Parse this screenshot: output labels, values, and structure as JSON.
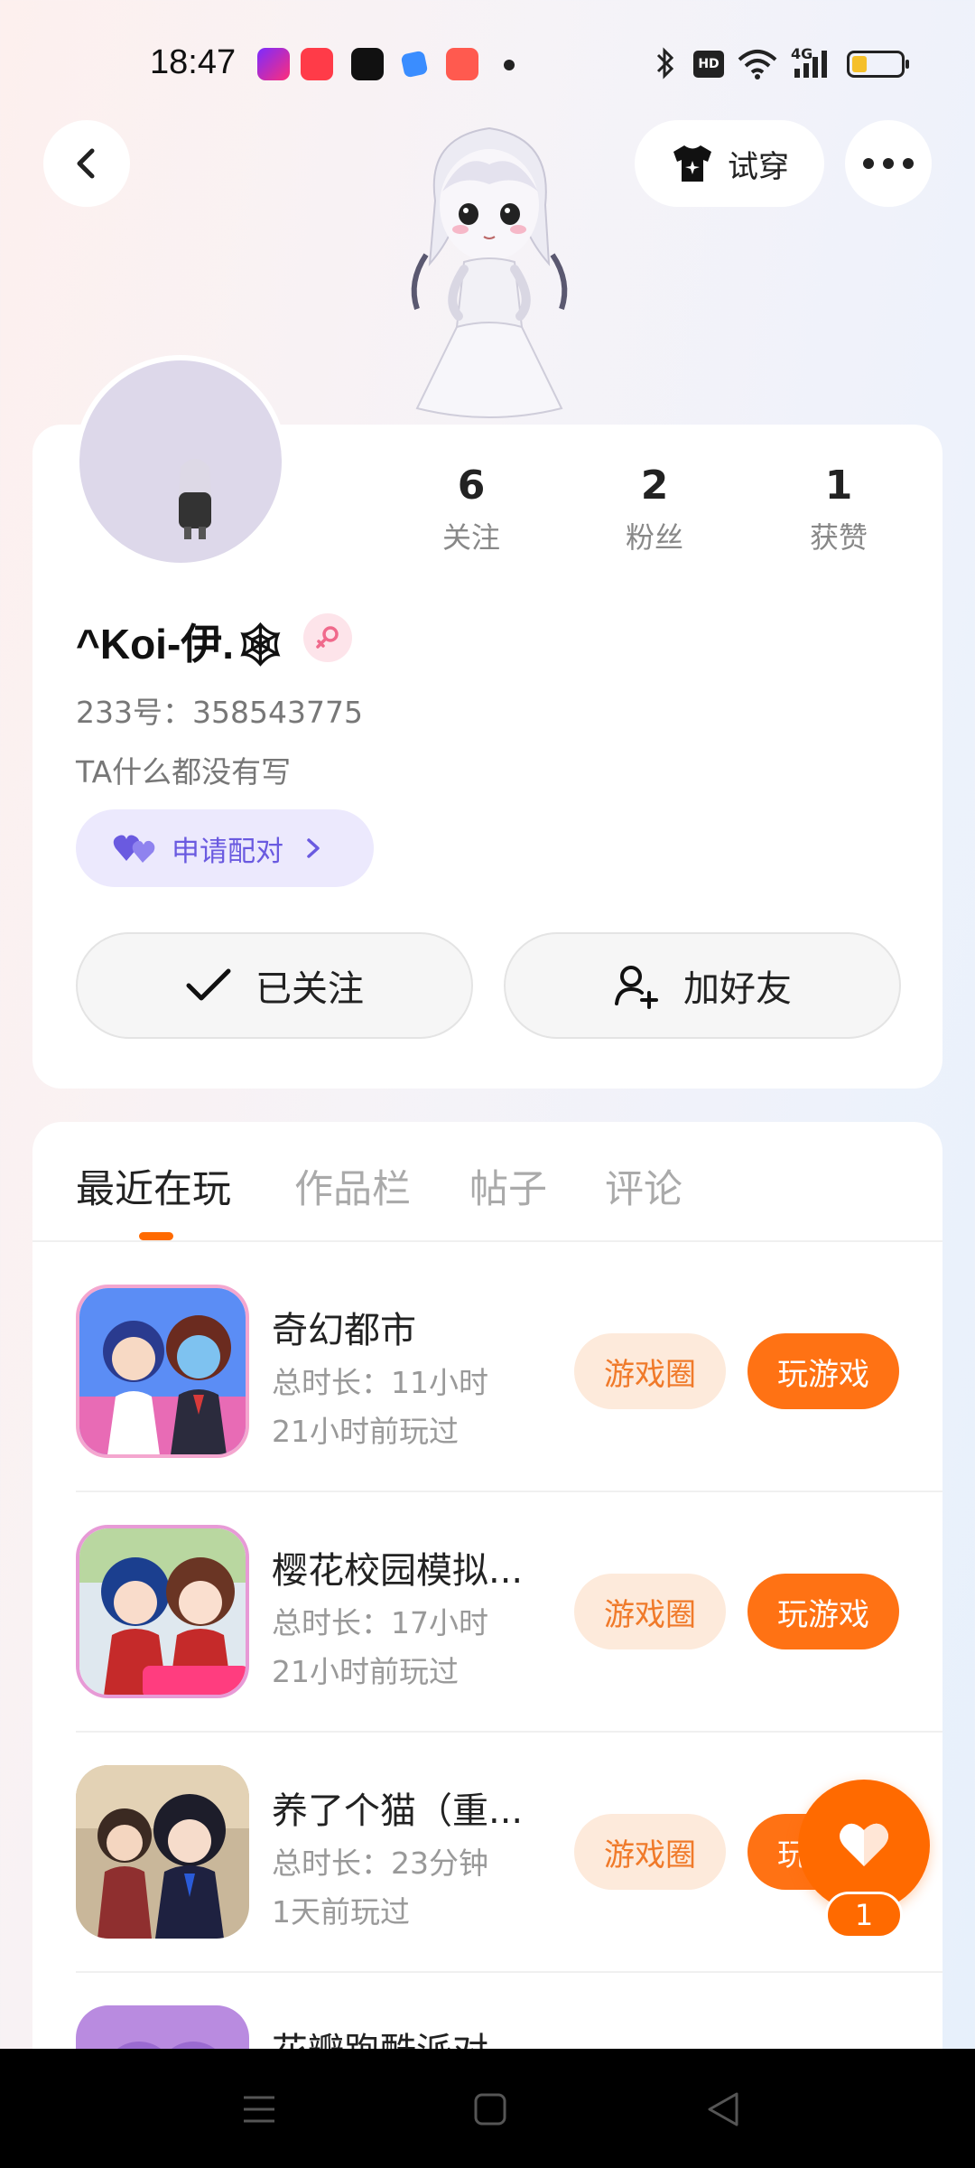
{
  "status_bar": {
    "time": "18:47",
    "network_label": "4G",
    "hd_label": "HD"
  },
  "header": {
    "tryon_label": "试穿"
  },
  "profile": {
    "stats": [
      {
        "value": "6",
        "label": "关注"
      },
      {
        "value": "2",
        "label": "粉丝"
      },
      {
        "value": "1",
        "label": "获赞"
      }
    ],
    "nickname": "^Koi-伊.🕸",
    "uid_text": "233号：358543775",
    "bio": "TA什么都没有写",
    "match_label": "申请配对",
    "followed_label": "已关注",
    "add_friend_label": "加好友"
  },
  "tabs": [
    {
      "label": "最近在玩",
      "active": true
    },
    {
      "label": "作品栏",
      "active": false
    },
    {
      "label": "帖子",
      "active": false
    },
    {
      "label": "评论",
      "active": false
    }
  ],
  "games": [
    {
      "title": "奇幻都市",
      "duration": "总时长：11小时",
      "last_played": "21小时前玩过",
      "circle_label": "游戏圈",
      "play_label": "玩游戏"
    },
    {
      "title": "樱花校园模拟...",
      "duration": "总时长：17小时",
      "last_played": "21小时前玩过",
      "circle_label": "游戏圈",
      "play_label": "玩游戏"
    },
    {
      "title": "养了个猫（重...",
      "duration": "总时长：23分钟",
      "last_played": "1天前玩过",
      "circle_label": "游戏圈",
      "play_label": "玩游戏"
    },
    {
      "title": "花瓣跑酷派对"
    }
  ],
  "like": {
    "count": "1"
  },
  "colors": {
    "accent": "#ff6a00",
    "match_purple": "#6a5ae0"
  }
}
